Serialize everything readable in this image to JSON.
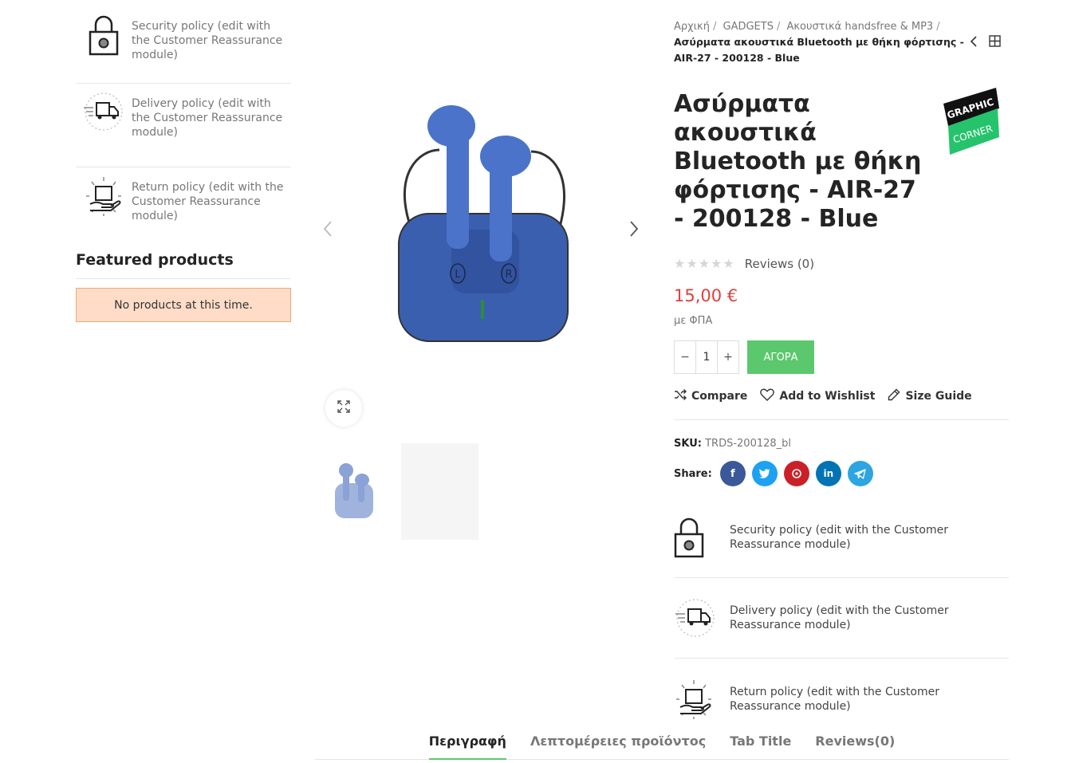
{
  "sidebar": {
    "reassurance": [
      {
        "icon": "lock-icon",
        "text": "Security policy (edit with the Customer Reassurance module)"
      },
      {
        "icon": "delivery-truck-icon",
        "text": "Delivery policy (edit with the Customer Reassurance module)"
      },
      {
        "icon": "return-box-icon",
        "text": "Return policy (edit with the Customer Reassurance module)"
      }
    ],
    "featured_title": "Featured products",
    "no_products": "No products at this time."
  },
  "breadcrumb": {
    "items": [
      "Αρχική",
      "GADGETS",
      "Ακουστικά handsfree & MP3"
    ],
    "current": "Ασύρματα ακουστικά Bluetooth με θήκη φόρτισης - AIR-27 - 200128 - Blue"
  },
  "product": {
    "title": "Ασύρματα ακουστικά Bluetooth με θήκη φόρτισης - AIR-27 - 200128 - Blue",
    "brand_logo": {
      "line1": "GRAPHIC",
      "line2": "CORNER"
    },
    "rating_stars": 0,
    "reviews_label": "Reviews (0)",
    "price": "15,00 €",
    "tax_note": "με ΦΠΑ",
    "quantity": "1",
    "buy_label": "ΑΓΟΡΑ",
    "actions": {
      "compare": "Compare",
      "wishlist": "Add to Wishlist",
      "size_guide": "Size Guide"
    },
    "sku_label": "SKU:",
    "sku_value": "TRDS-200128_bl",
    "share_label": "Share:",
    "share_icons": [
      "facebook-icon",
      "twitter-icon",
      "pinterest-icon",
      "linkedin-icon",
      "telegram-icon"
    ],
    "earbud_labels": {
      "left": "L",
      "right": "R"
    }
  },
  "policies": [
    {
      "icon": "lock-icon",
      "text": "Security policy (edit with the Customer Reassurance module)"
    },
    {
      "icon": "delivery-truck-icon",
      "text": "Delivery policy (edit with the Customer Reassurance module)"
    },
    {
      "icon": "return-box-icon",
      "text": "Return policy (edit with the Customer Reassurance module)"
    }
  ],
  "tabs": [
    "Περιγραφή",
    "Λεπτομέρειες προϊόντος",
    "Tab Title",
    "Reviews(0)"
  ],
  "active_tab": 0,
  "colors": {
    "accent": "#5cc86d",
    "price": "#e0403c",
    "facebook": "#3b5998",
    "twitter": "#1da1f2",
    "pinterest": "#cb2027",
    "linkedin": "#0274b3",
    "telegram": "#2ca5e0"
  }
}
